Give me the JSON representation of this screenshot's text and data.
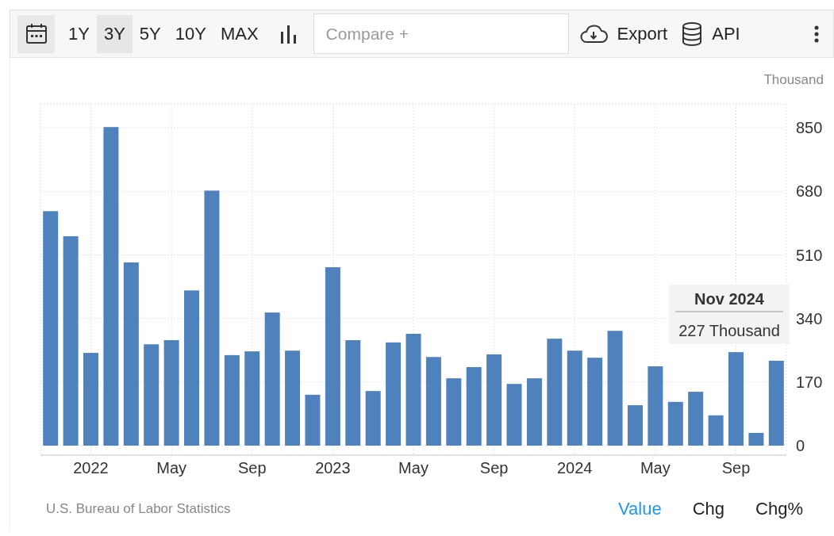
{
  "toolbar": {
    "ranges": [
      {
        "label": "1Y",
        "selected": false
      },
      {
        "label": "3Y",
        "selected": true
      },
      {
        "label": "5Y",
        "selected": false
      },
      {
        "label": "10Y",
        "selected": false
      },
      {
        "label": "MAX",
        "selected": false
      }
    ],
    "compare": {
      "placeholder": "Compare +"
    },
    "export_label": "Export",
    "api_label": "API"
  },
  "chart": {
    "tooltip": {
      "title": "Nov 2024",
      "text": "227 Thousand"
    },
    "chart_data": {
      "type": "bar",
      "ylabel": "Thousand",
      "grid": true,
      "categories": [
        null,
        null,
        "2022",
        null,
        null,
        null,
        "May",
        null,
        null,
        null,
        "Sep",
        null,
        null,
        null,
        "2023",
        null,
        null,
        null,
        "May",
        null,
        null,
        null,
        "Sep",
        null,
        null,
        null,
        "2024",
        null,
        null,
        null,
        "May",
        null,
        null,
        null,
        "Sep",
        null,
        null
      ],
      "series": [
        {
          "color": "#4f81bd",
          "values": [
            627,
            560,
            248,
            852,
            490,
            271,
            282,
            415,
            682,
            242,
            252,
            356,
            254,
            136,
            477,
            282,
            146,
            276,
            299,
            237,
            180,
            210,
            244,
            165,
            180,
            286,
            254,
            235,
            307,
            108,
            212,
            117,
            144,
            81,
            250,
            34,
            227
          ]
        }
      ],
      "ylim": [
        0,
        914
      ],
      "yticks": [
        0,
        170,
        340,
        510,
        680,
        850
      ]
    }
  },
  "footer": {
    "source": "U.S. Bureau of Labor Statistics",
    "views": [
      {
        "label": "Value",
        "selected": true
      },
      {
        "label": "Chg",
        "selected": false
      },
      {
        "label": "Chg%",
        "selected": false
      }
    ]
  }
}
